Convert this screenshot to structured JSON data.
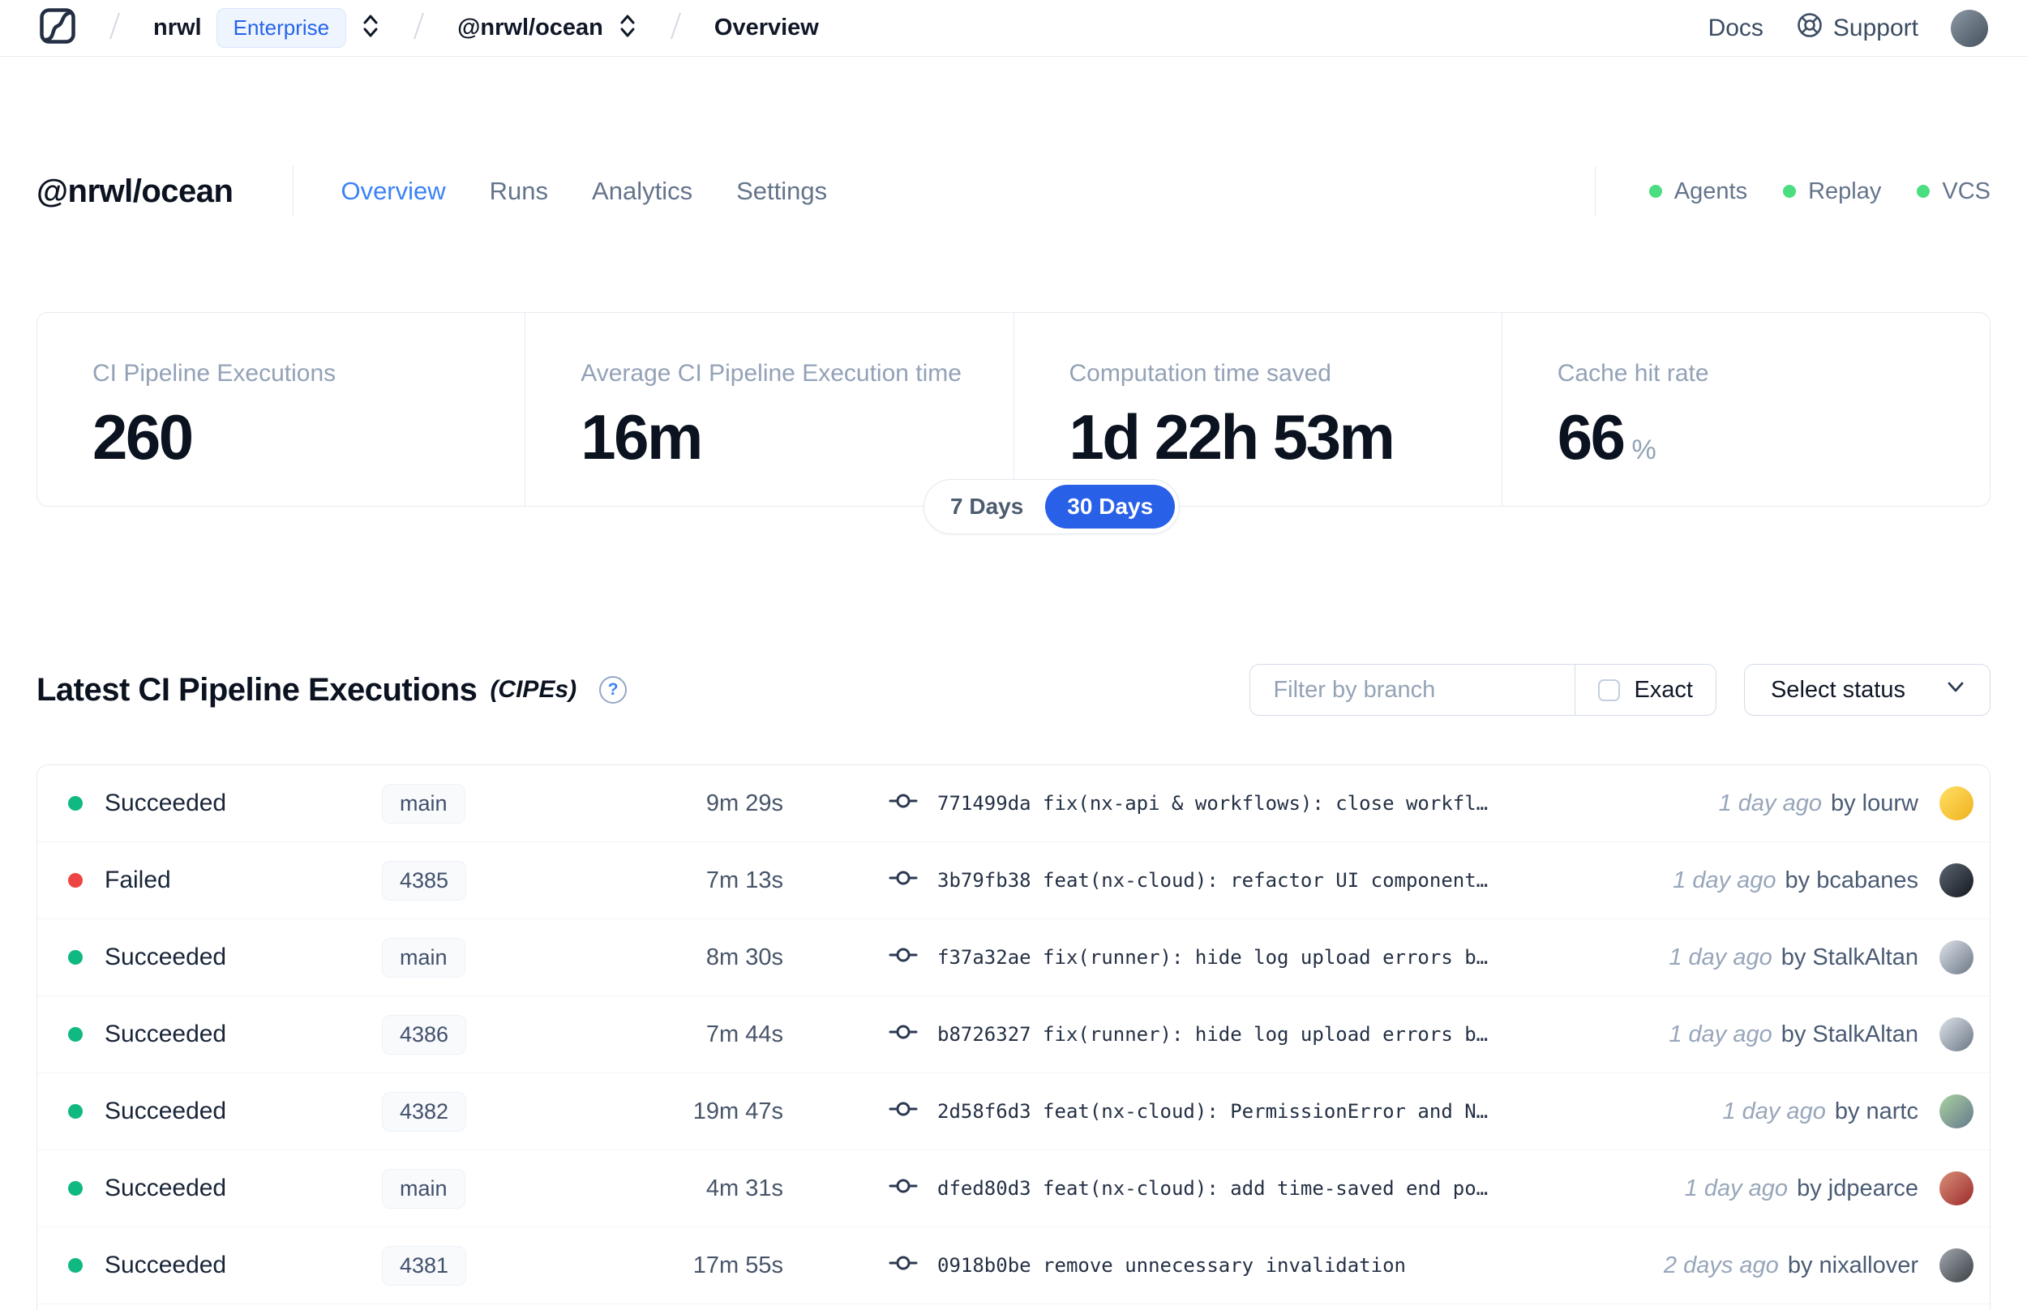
{
  "colors": {
    "accent_blue": "#2563eb",
    "active_tab_blue": "#3b82f6",
    "service_green": "#4ade80",
    "success_green": "#10b981",
    "failed_red": "#ef4444"
  },
  "topbar": {
    "breadcrumb": {
      "org": "nrwl",
      "org_badge": "Enterprise",
      "workspace": "@nrwl/ocean",
      "page": "Overview"
    },
    "docs_label": "Docs",
    "support_label": "Support",
    "avatar_colors": [
      "#8d9aa6",
      "#44505c"
    ]
  },
  "header": {
    "title": "@nrwl/ocean",
    "tabs": [
      {
        "label": "Overview",
        "active": true
      },
      {
        "label": "Runs",
        "active": false
      },
      {
        "label": "Analytics",
        "active": false
      },
      {
        "label": "Settings",
        "active": false
      }
    ],
    "services": [
      {
        "label": "Agents"
      },
      {
        "label": "Replay"
      },
      {
        "label": "VCS"
      }
    ]
  },
  "stats": {
    "cards": [
      {
        "label": "CI Pipeline Executions",
        "value": "260",
        "suffix": ""
      },
      {
        "label": "Average CI Pipeline Execution time",
        "value": "16m",
        "suffix": ""
      },
      {
        "label": "Computation time saved",
        "value": "1d 22h 53m",
        "suffix": ""
      },
      {
        "label": "Cache hit rate",
        "value": "66",
        "suffix": "%"
      }
    ],
    "range_toggle": {
      "options": [
        "7 Days",
        "30 Days"
      ],
      "selected": "30 Days"
    }
  },
  "cipes": {
    "title": "Latest CI Pipeline Executions",
    "title_suffix": "(CIPEs)",
    "help_icon": "?",
    "filter": {
      "placeholder": "Filter by branch",
      "exact_label": "Exact",
      "status_label": "Select status"
    },
    "rows": [
      {
        "status": "Succeeded",
        "dot": "#10b981",
        "branch": "main",
        "duration": "9m 29s",
        "commit": "771499da fix(nx-api & workflows): close workfl…",
        "time": "1 day ago",
        "author": "by lourw",
        "avatar": [
          "#ffe066",
          "#f0b11c"
        ]
      },
      {
        "status": "Failed",
        "dot": "#ef4444",
        "branch": "4385",
        "duration": "7m 13s",
        "commit": "3b79fb38 feat(nx-cloud): refactor UI component…",
        "time": "1 day ago",
        "author": "by bcabanes",
        "avatar": [
          "#5b6672",
          "#14181f"
        ]
      },
      {
        "status": "Succeeded",
        "dot": "#10b981",
        "branch": "main",
        "duration": "8m 30s",
        "commit": "f37a32ae fix(runner): hide log upload errors b…",
        "time": "1 day ago",
        "author": "by StalkAltan",
        "avatar": [
          "#dde3e9",
          "#6b7685"
        ]
      },
      {
        "status": "Succeeded",
        "dot": "#10b981",
        "branch": "4386",
        "duration": "7m 44s",
        "commit": "b8726327 fix(runner): hide log upload errors b…",
        "time": "1 day ago",
        "author": "by StalkAltan",
        "avatar": [
          "#dde3e9",
          "#6b7685"
        ]
      },
      {
        "status": "Succeeded",
        "dot": "#10b981",
        "branch": "4382",
        "duration": "19m 47s",
        "commit": "2d58f6d3 feat(nx-cloud): PermissionError and N…",
        "time": "1 day ago",
        "author": "by nartc",
        "avatar": [
          "#a9d3a2",
          "#66788c"
        ]
      },
      {
        "status": "Succeeded",
        "dot": "#10b981",
        "branch": "main",
        "duration": "4m 31s",
        "commit": "dfed80d3 feat(nx-cloud): add time-saved end po…",
        "time": "1 day ago",
        "author": "by jdpearce",
        "avatar": [
          "#d99079",
          "#9c2a2a"
        ]
      },
      {
        "status": "Succeeded",
        "dot": "#10b981",
        "branch": "4381",
        "duration": "17m 55s",
        "commit": "0918b0be remove unnecessary invalidation",
        "time": "2 days ago",
        "author": "by nixallover",
        "avatar": [
          "#a3a8ae",
          "#3a3f46"
        ]
      }
    ]
  }
}
